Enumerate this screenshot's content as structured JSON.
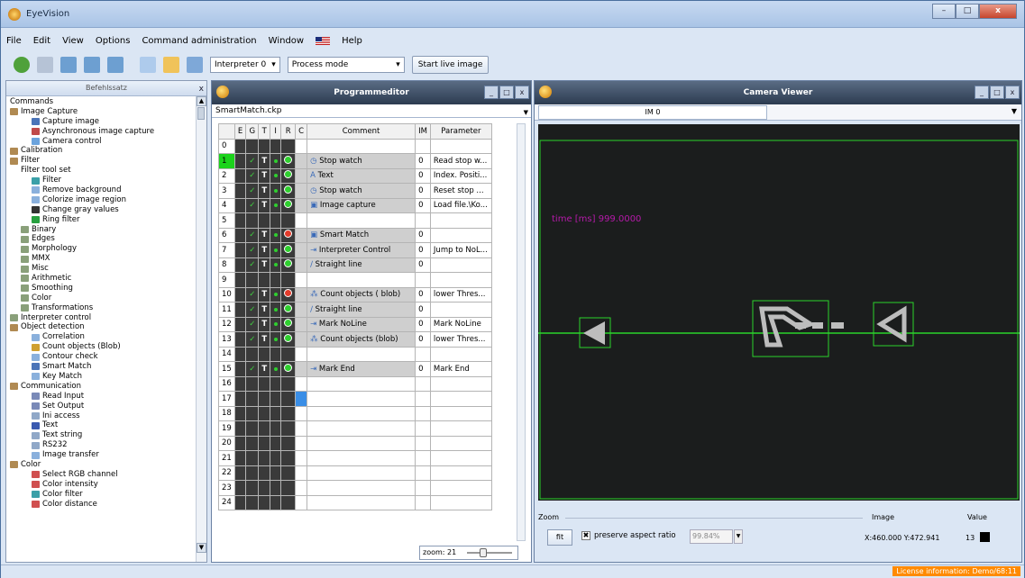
{
  "window": {
    "title": "EyeVision",
    "minimize_label": "–",
    "maximize_label": "□",
    "close_label": "x"
  },
  "menu": [
    "File",
    "Edit",
    "View",
    "Options",
    "Command administration",
    "Window",
    "Help"
  ],
  "toolbar": {
    "interpreter": "Interpreter 0",
    "mode": "Process mode",
    "live_button": "Start live image"
  },
  "commands_panel": {
    "header": "Befehlssatz",
    "close_label": "x",
    "tree": [
      {
        "label": "Commands",
        "level": 0,
        "icon": "none"
      },
      {
        "label": "Image Capture",
        "level": 0,
        "icon": "folder"
      },
      {
        "label": "Capture image",
        "level": 2,
        "icon": "camera"
      },
      {
        "label": "Asynchronous image capture",
        "level": 2,
        "icon": "camera-red"
      },
      {
        "label": "Camera control",
        "level": 2,
        "icon": "camera-blue"
      },
      {
        "label": "Calibration",
        "level": 0,
        "icon": "folder"
      },
      {
        "label": "Filter",
        "level": 0,
        "icon": "folder"
      },
      {
        "label": "Filter tool set",
        "level": 1,
        "icon": "none"
      },
      {
        "label": "Filter",
        "level": 2,
        "icon": "filter"
      },
      {
        "label": "Remove background",
        "level": 2,
        "icon": "image"
      },
      {
        "label": "Colorize image region",
        "level": 2,
        "icon": "image"
      },
      {
        "label": "Change gray values",
        "level": 2,
        "icon": "pencil"
      },
      {
        "label": "Ring filter",
        "level": 2,
        "icon": "ring"
      },
      {
        "label": "Binary",
        "level": 1,
        "icon": "folder-small"
      },
      {
        "label": "Edges",
        "level": 1,
        "icon": "folder-small"
      },
      {
        "label": "Morphology",
        "level": 1,
        "icon": "folder-small"
      },
      {
        "label": "MMX",
        "level": 1,
        "icon": "folder-small"
      },
      {
        "label": "Misc",
        "level": 1,
        "icon": "folder-small"
      },
      {
        "label": "Arithmetic",
        "level": 1,
        "icon": "folder-small"
      },
      {
        "label": "Smoothing",
        "level": 1,
        "icon": "folder-small"
      },
      {
        "label": "Color",
        "level": 1,
        "icon": "folder-small"
      },
      {
        "label": "Transformations",
        "level": 1,
        "icon": "folder-small"
      },
      {
        "label": "Interpreter control",
        "level": 0,
        "icon": "folder-small"
      },
      {
        "label": "Object detection",
        "level": 0,
        "icon": "folder"
      },
      {
        "label": "Correlation",
        "level": 2,
        "icon": "image"
      },
      {
        "label": "Count objects (Blob)",
        "level": 2,
        "icon": "blob"
      },
      {
        "label": "Contour check",
        "level": 2,
        "icon": "image"
      },
      {
        "label": "Smart Match",
        "level": 2,
        "icon": "camera"
      },
      {
        "label": "Key Match",
        "level": 2,
        "icon": "image"
      },
      {
        "label": "Communication",
        "level": 0,
        "icon": "folder"
      },
      {
        "label": "Read Input",
        "level": 2,
        "icon": "io"
      },
      {
        "label": "Set Output",
        "level": 2,
        "icon": "io"
      },
      {
        "label": "Ini access",
        "level": 2,
        "icon": "doc"
      },
      {
        "label": "Text",
        "level": 2,
        "icon": "text"
      },
      {
        "label": "Text string",
        "level": 2,
        "icon": "doc"
      },
      {
        "label": "RS232",
        "level": 2,
        "icon": "doc"
      },
      {
        "label": "Image transfer",
        "level": 2,
        "icon": "image"
      },
      {
        "label": "Color",
        "level": 0,
        "icon": "folder"
      },
      {
        "label": "Select RGB channel",
        "level": 2,
        "icon": "rgb"
      },
      {
        "label": "Color intensity",
        "level": 2,
        "icon": "rgb"
      },
      {
        "label": "Color filter",
        "level": 2,
        "icon": "filter"
      },
      {
        "label": "Color distance",
        "level": 2,
        "icon": "rgb"
      }
    ]
  },
  "program_editor": {
    "title": "Programmeditor",
    "file": "SmartMatch.ckp",
    "columns": [
      "E",
      "G",
      "T",
      "I",
      "R",
      "C",
      "Comment",
      "IM",
      "Parameter"
    ],
    "zoom_label": "zoom: 21",
    "rows": [
      {
        "n": "0",
        "flags": false,
        "status": "",
        "comment": "",
        "icon": "",
        "im": "",
        "param": ""
      },
      {
        "n": "1",
        "flags": true,
        "status": "green",
        "comment": "Stop watch",
        "icon": "clock",
        "im": "0",
        "param": "Read stop w..."
      },
      {
        "n": "2",
        "flags": true,
        "status": "green",
        "comment": "Text",
        "icon": "text",
        "im": "0",
        "param": "Index. Positi..."
      },
      {
        "n": "3",
        "flags": true,
        "status": "green",
        "comment": "Stop watch",
        "icon": "clock",
        "im": "0",
        "param": "Reset stop ..."
      },
      {
        "n": "4",
        "flags": true,
        "status": "green",
        "comment": "Image capture",
        "icon": "camera",
        "im": "0",
        "param": "Load file.\\Ko..."
      },
      {
        "n": "5",
        "flags": false,
        "status": "",
        "comment": "",
        "icon": "",
        "im": "",
        "param": ""
      },
      {
        "n": "6",
        "flags": true,
        "status": "red",
        "comment": "Smart Match",
        "icon": "camera",
        "im": "0",
        "param": ""
      },
      {
        "n": "7",
        "flags": true,
        "status": "green",
        "comment": "Interpreter Control",
        "icon": "jump",
        "im": "0",
        "param": "Jump to NoL..."
      },
      {
        "n": "8",
        "flags": true,
        "status": "green",
        "comment": "Straight line",
        "icon": "line",
        "im": "0",
        "param": ""
      },
      {
        "n": "9",
        "flags": false,
        "status": "",
        "comment": "",
        "icon": "",
        "im": "",
        "param": ""
      },
      {
        "n": "10",
        "flags": true,
        "status": "red",
        "comment": "Count objects ( blob)",
        "icon": "blob",
        "im": "0",
        "param": "lower Thres..."
      },
      {
        "n": "11",
        "flags": true,
        "status": "green",
        "comment": "Straight line",
        "icon": "line",
        "im": "0",
        "param": ""
      },
      {
        "n": "12",
        "flags": true,
        "status": "green",
        "comment": "Mark NoLine",
        "icon": "jump",
        "im": "0",
        "param": "Mark NoLine"
      },
      {
        "n": "13",
        "flags": true,
        "status": "green",
        "comment": "Count objects (blob)",
        "icon": "blob",
        "im": "0",
        "param": "lower Thres..."
      },
      {
        "n": "14",
        "flags": false,
        "status": "",
        "comment": "",
        "icon": "",
        "im": "",
        "param": ""
      },
      {
        "n": "15",
        "flags": true,
        "status": "green",
        "comment": "Mark End",
        "icon": "jump",
        "im": "0",
        "param": "Mark End"
      },
      {
        "n": "16",
        "flags": false,
        "status": "",
        "comment": "",
        "icon": "",
        "im": "",
        "param": ""
      },
      {
        "n": "17",
        "flags": false,
        "status": "",
        "comment": "",
        "icon": "",
        "im": "",
        "param": ""
      },
      {
        "n": "18",
        "flags": false,
        "status": "",
        "comment": "",
        "icon": "",
        "im": "",
        "param": ""
      },
      {
        "n": "19",
        "flags": false,
        "status": "",
        "comment": "",
        "icon": "",
        "im": "",
        "param": ""
      },
      {
        "n": "20",
        "flags": false,
        "status": "",
        "comment": "",
        "icon": "",
        "im": "",
        "param": ""
      },
      {
        "n": "21",
        "flags": false,
        "status": "",
        "comment": "",
        "icon": "",
        "im": "",
        "param": ""
      },
      {
        "n": "22",
        "flags": false,
        "status": "",
        "comment": "",
        "icon": "",
        "im": "",
        "param": ""
      },
      {
        "n": "23",
        "flags": false,
        "status": "",
        "comment": "",
        "icon": "",
        "im": "",
        "param": ""
      },
      {
        "n": "24",
        "flags": false,
        "status": "",
        "comment": "",
        "icon": "",
        "im": "",
        "param": ""
      }
    ]
  },
  "camera_viewer": {
    "title": "Camera Viewer",
    "tab": "IM 0",
    "overlay_text": "time [ms] 999.0000",
    "zoom_label": "Zoom",
    "fit_label": "fit",
    "preserve_label": "preserve aspect ratio",
    "zoom_percent": "99.84%",
    "image_label": "Image",
    "image_coords": "X:460.000 Y:472.941",
    "value_label": "Value",
    "value": "13"
  },
  "status": {
    "license": "License information: Demo/68:11"
  }
}
